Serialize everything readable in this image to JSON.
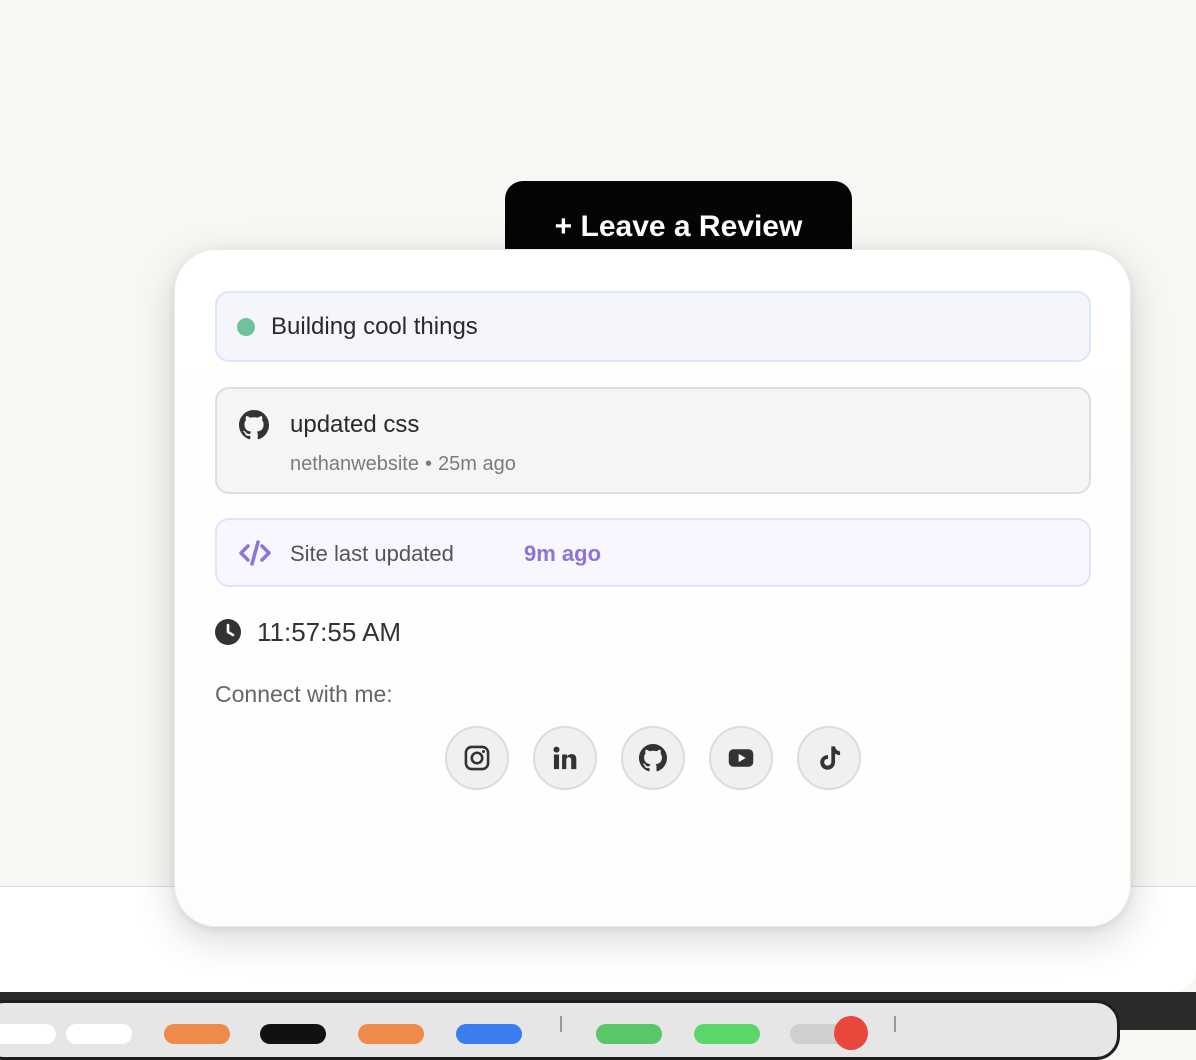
{
  "review_button": {
    "label": "+ Leave a Review"
  },
  "status": {
    "text": "Building cool things",
    "dot_color": "#6fc39a"
  },
  "commit": {
    "message": "updated css",
    "repo": "nethanwebsite",
    "separator": "•",
    "time_ago": "25m ago",
    "icon": "github-icon"
  },
  "site_update": {
    "label": "Site last updated",
    "value": "9m ago",
    "icon": "code-icon",
    "accent": "#8e74d8"
  },
  "clock": {
    "time": "11:57:55 AM",
    "icon": "clock-icon"
  },
  "connect": {
    "label": "Connect with me:",
    "socials": [
      {
        "name": "instagram",
        "icon": "instagram-icon"
      },
      {
        "name": "linkedin",
        "icon": "linkedin-icon"
      },
      {
        "name": "github",
        "icon": "github-icon"
      },
      {
        "name": "youtube",
        "icon": "youtube-icon"
      },
      {
        "name": "tiktok",
        "icon": "tiktok-icon"
      }
    ]
  }
}
